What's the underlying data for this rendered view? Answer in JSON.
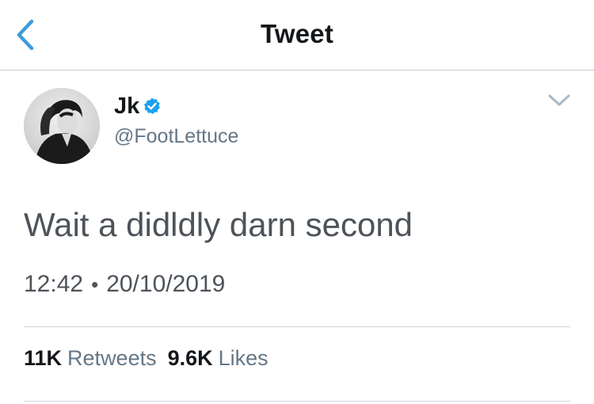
{
  "header": {
    "title": "Tweet",
    "back_icon": "chevron-left-icon",
    "accent_color": "#3e9bd9"
  },
  "tweet": {
    "author": {
      "display_name": "Jk",
      "handle": "@FootLettuce",
      "verified": true,
      "verified_color": "#1da1f2"
    },
    "text": "Wait a didldly darn second",
    "time": "12:42",
    "separator": "•",
    "date": "20/10/2019",
    "menu_icon": "chevron-down-icon"
  },
  "stats": {
    "retweets_count": "11K",
    "retweets_label": "Retweets",
    "likes_count": "9.6K",
    "likes_label": "Likes"
  }
}
